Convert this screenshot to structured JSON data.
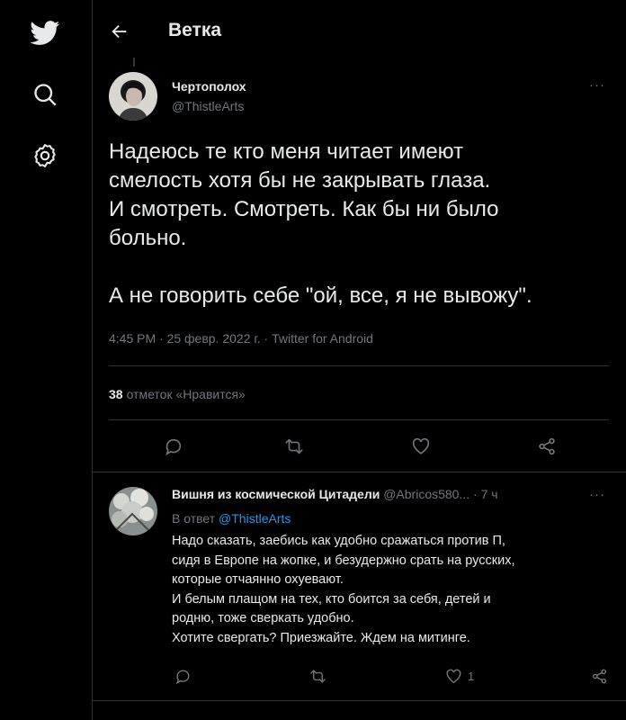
{
  "header": {
    "title": "Ветка"
  },
  "nav": {
    "icons": [
      "twitter-bird-icon",
      "search-icon",
      "gear-icon"
    ]
  },
  "tweet": {
    "author_name": "Чертополох",
    "author_handle": "@ThistleArts",
    "more": "···",
    "text": "Надеюсь те кто меня читает имеют\nсмелость хотя бы не закрывать глаза.\nИ смотреть. Смотреть. Как бы ни было\nбольно.\n\nА не говорить себе \"ой, все, я не вывожу\".",
    "meta": "4:45 PM · 25 февр. 2022 г. · Twitter for Android",
    "likes_count": "38",
    "likes_label": "отметок «Нравится»"
  },
  "reply": {
    "author_name": "Вишня из космической Цитадели",
    "author_handle": "@Abricos580...",
    "dot": " · ",
    "time": "7 ч",
    "more": "···",
    "replying_prefix": "В ответ ",
    "replying_to": "@ThistleArts",
    "text": "Надо сказать, заебись как удобно сражаться против П,\nсидя в Европе на жопке, и безудержно срать на русских,\nкоторые отчаянно охуевают.\nИ белым плащом на тех, кто боится за себя, детей и\nродню, тоже сверкать удобно.\nХотите свергать? Приезжайте. Ждем на митинге.",
    "like_count": "1"
  },
  "colors": {
    "background": "#000000",
    "text": "#e7e9ea",
    "muted": "#71767b",
    "link": "#1d9bf0",
    "divider": "#2f3336"
  }
}
